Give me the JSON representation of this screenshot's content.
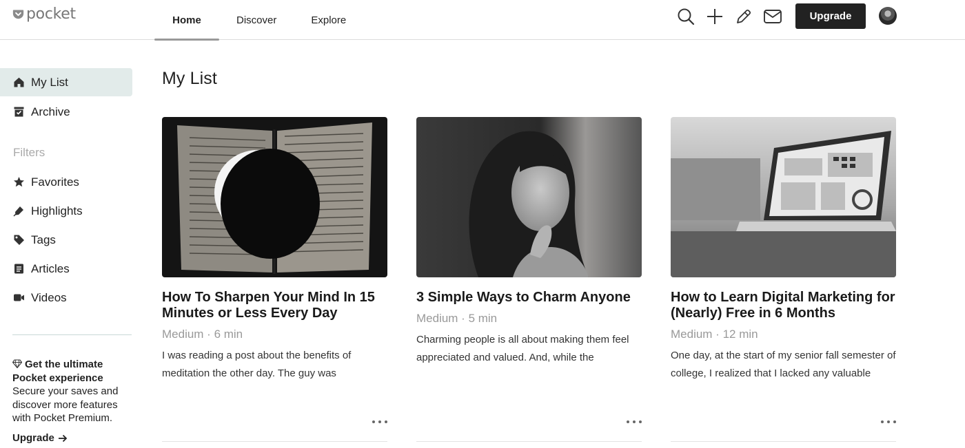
{
  "app": {
    "logo_text": "pocket"
  },
  "nav": {
    "tabs": [
      {
        "label": "Home",
        "active": true
      },
      {
        "label": "Discover",
        "active": false
      },
      {
        "label": "Explore",
        "active": false
      }
    ]
  },
  "toolbar": {
    "icons": [
      "search-icon",
      "add-icon",
      "pencil-icon",
      "mail-icon"
    ],
    "upgrade_label": "Upgrade"
  },
  "sidebar": {
    "items": [
      {
        "label": "My List",
        "icon": "home-icon",
        "active": true
      },
      {
        "label": "Archive",
        "icon": "archive-icon",
        "active": false
      }
    ],
    "filters_label": "Filters",
    "filters": [
      {
        "label": "Favorites",
        "icon": "star-icon"
      },
      {
        "label": "Highlights",
        "icon": "highlighter-icon"
      },
      {
        "label": "Tags",
        "icon": "tag-icon"
      },
      {
        "label": "Articles",
        "icon": "article-icon"
      },
      {
        "label": "Videos",
        "icon": "video-icon"
      }
    ],
    "promo": {
      "title": "Get the ultimate Pocket experience",
      "body": "Secure your saves and discover more features with Pocket Premium.",
      "upgrade_label": "Upgrade"
    }
  },
  "main": {
    "page_title": "My List",
    "cards": [
      {
        "title": "How To Sharpen Your Mind In 15 Minutes or Less Every Day",
        "meta": "Medium · 6 min",
        "excerpt": "I was reading a post about the benefits of meditation the other day. The guy was"
      },
      {
        "title": "3 Simple Ways to Charm Anyone",
        "meta": "Medium · 5 min",
        "excerpt": "Charming people is all about making them feel appreciated and valued. And, while the"
      },
      {
        "title": "How to Learn Digital Marketing for (Nearly) Free in 6 Months",
        "meta": "Medium · 12 min",
        "excerpt": "One day, at the start of my senior fall semester of college, I realized that I lacked any valuable"
      }
    ]
  },
  "colors": {
    "active_bg": "#e2ebea",
    "button_bg": "#222222",
    "muted_text": "#999999"
  }
}
